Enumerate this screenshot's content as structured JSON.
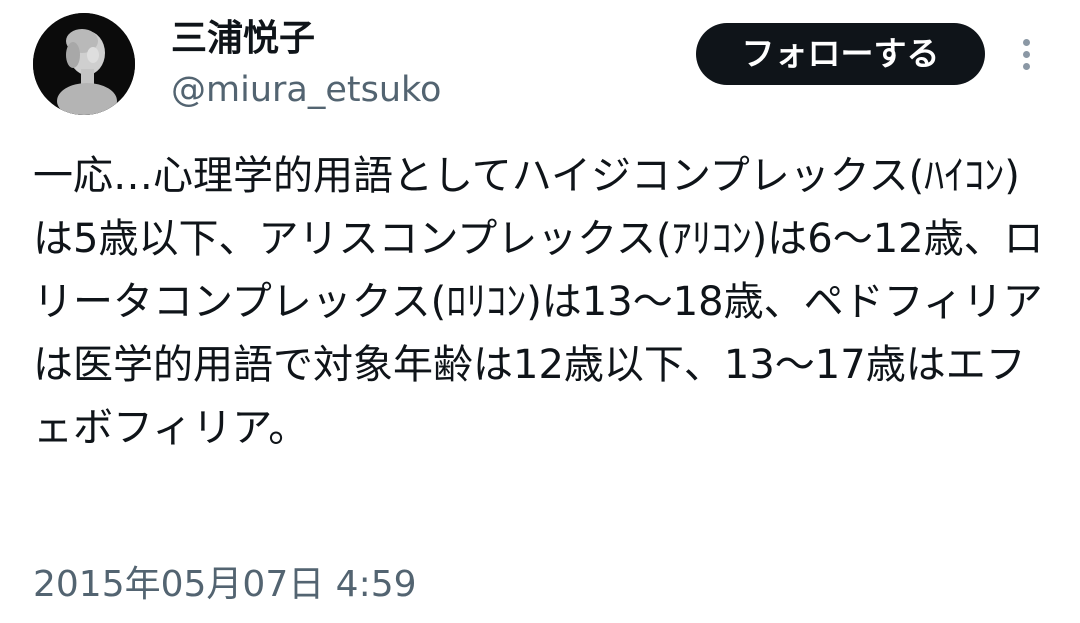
{
  "user": {
    "display_name": "三浦悦子",
    "handle": "@miura_etsuko"
  },
  "actions": {
    "follow_label": "フォローする"
  },
  "tweet": {
    "text": "一応…心理学的用語としてハイジコンプレックス(ﾊｲｺﾝ)は5歳以下、アリスコンプレックス(ｱﾘｺﾝ)は6〜12歳、ロリータコンプレックス(ﾛﾘｺﾝ)は13〜18歳、ペドフィリアは医学的用語で対象年齢は12歳以下、13〜17歳はエフェボフィリア。",
    "timestamp": "2015年05月07日 4:59"
  },
  "icons": {
    "avatar": "avatar-image",
    "more": "more-options-icon"
  },
  "colors": {
    "button_bg": "#0f1419",
    "text_primary": "#0f1419",
    "text_secondary": "#536471"
  }
}
